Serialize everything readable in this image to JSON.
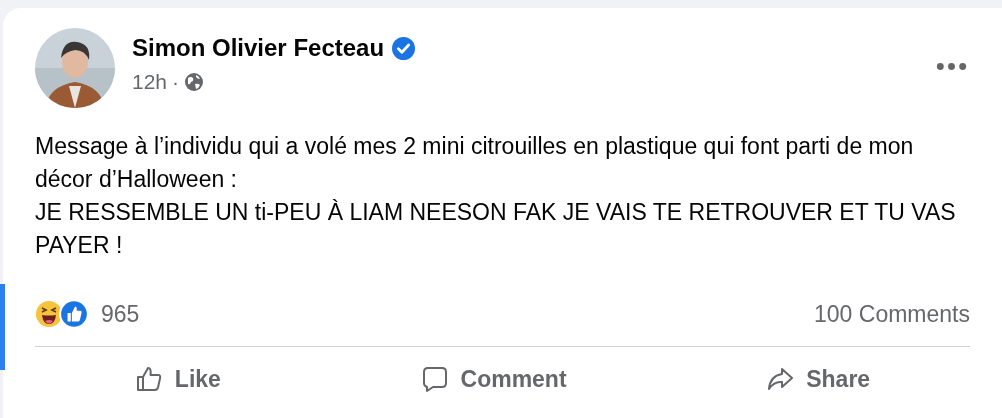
{
  "post": {
    "author": "Simon Olivier Fecteau",
    "verified": true,
    "time": "12h",
    "separator": "·",
    "avatar": {
      "kind": "picture"
    },
    "paragraphs": [
      "Message à l’individu qui a volé mes 2 mini citrouilles en plastique qui font parti de mon décor d’Halloween :",
      "JE RESSEMBLE UN ti-PEU À LIAM NEESON FAK JE VAIS TE RETROUVER ET TU VAS PAYER !"
    ],
    "reactions": {
      "count": "965",
      "comments": "100 Comments"
    },
    "actions": [
      {
        "kind": "like",
        "label": "Like"
      },
      {
        "kind": "comment",
        "label": "Comment"
      },
      {
        "kind": "share",
        "label": "Share"
      }
    ]
  }
}
